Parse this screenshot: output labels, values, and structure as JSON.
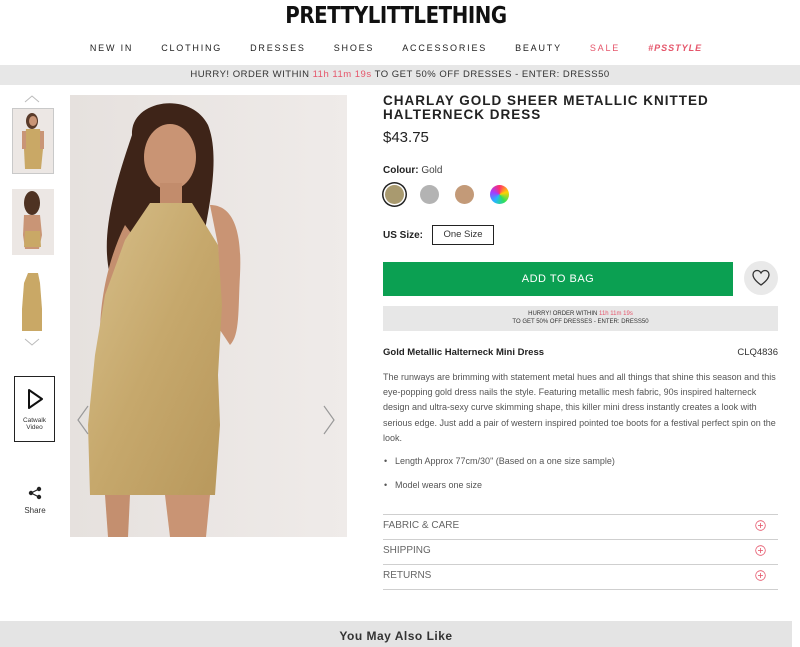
{
  "brand": {
    "logo": "PRETTYLITTLETHING"
  },
  "nav": {
    "items": [
      "NEW IN",
      "CLOTHING",
      "DRESSES",
      "SHOES",
      "ACCESSORIES",
      "BEAUTY",
      "SALE",
      "#PSSTYLE"
    ]
  },
  "promo": {
    "prefix": "HURRY! ORDER WITHIN",
    "timer": "11h 11m 19s",
    "suffix": "TO GET 50% OFF DRESSES - ENTER: DRESS50"
  },
  "gallery": {
    "catwalk_label": "Catwalk Video",
    "share_label": "Share"
  },
  "product": {
    "title": "CHARLAY GOLD SHEER METALLIC KNITTED HALTERNECK DRESS",
    "price": "$43.75",
    "colour_label": "Colour:",
    "colour_value": "Gold",
    "swatches": [
      {
        "name": "gold",
        "color": "#a99a6f",
        "selected": true
      },
      {
        "name": "silver",
        "color": "#b3b3b3",
        "selected": false
      },
      {
        "name": "rose-gold",
        "color": "#c39a78",
        "selected": false
      },
      {
        "name": "multi",
        "color": "#ff4fa0",
        "selected": false
      }
    ],
    "size_label": "US Size:",
    "size_value": "One Size",
    "add_to_bag": "ADD TO BAG",
    "promo_small_line1_prefix": "HURRY! ORDER WITHIN",
    "promo_small_timer": "11h 11m 19s",
    "promo_small_line2": "TO GET 50% OFF DRESSES - ENTER: DRESS50",
    "name": "Gold Metallic Halterneck Mini Dress",
    "code": "CLQ4836",
    "description": "The runways are brimming with statement metal hues and all things that shine this season and this eye-popping gold dress nails the style. Featuring metallic mesh fabric, 90s inspired halterneck design and ultra-sexy curve skimming shape, this killer mini dress instantly creates a look with serious edge. Just add a pair of western inspired pointed toe boots for a festival perfect spin on the look.",
    "bullets": [
      "Length Approx 77cm/30\" (Based on a one size sample)",
      "Model wears one size"
    ],
    "accordions": [
      "FABRIC & CARE",
      "SHIPPING",
      "RETURNS"
    ]
  },
  "recommendations": {
    "heading": "You May Also Like"
  },
  "colors": {
    "accent_pink": "#e5566b",
    "add_to_bag_green": "#0ba052"
  }
}
